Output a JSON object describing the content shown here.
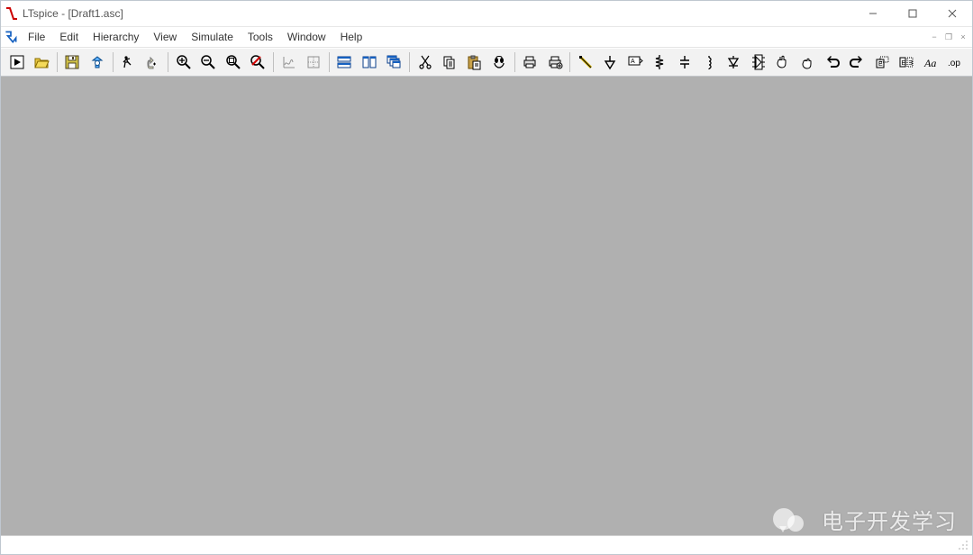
{
  "window": {
    "title": "LTspice - [Draft1.asc]"
  },
  "menus": {
    "file": "File",
    "edit": "Edit",
    "hierarchy": "Hierarchy",
    "view": "View",
    "simulate": "Simulate",
    "tools": "Tools",
    "window": "Window",
    "help": "Help"
  },
  "status": {
    "left": ""
  },
  "watermark": {
    "text": "电子开发学习"
  },
  "toolbar_buttons": [
    {
      "name": "run-simulation",
      "enabled": true
    },
    {
      "name": "open-file",
      "enabled": true
    },
    {
      "name": "separator"
    },
    {
      "name": "save",
      "enabled": true
    },
    {
      "name": "control-panel",
      "enabled": true
    },
    {
      "name": "separator"
    },
    {
      "name": "run-man",
      "enabled": true
    },
    {
      "name": "halt",
      "enabled": true
    },
    {
      "name": "separator"
    },
    {
      "name": "zoom-in",
      "enabled": true
    },
    {
      "name": "zoom-out",
      "enabled": true
    },
    {
      "name": "zoom-fit",
      "enabled": true
    },
    {
      "name": "zoom-pan-off",
      "enabled": true
    },
    {
      "name": "separator"
    },
    {
      "name": "autorange-y",
      "enabled": false
    },
    {
      "name": "autorange-x",
      "enabled": false
    },
    {
      "name": "separator"
    },
    {
      "name": "tile-horiz",
      "enabled": true
    },
    {
      "name": "tile-vert",
      "enabled": true
    },
    {
      "name": "cascade",
      "enabled": true
    },
    {
      "name": "separator"
    },
    {
      "name": "cut",
      "enabled": true
    },
    {
      "name": "copy",
      "enabled": true
    },
    {
      "name": "paste",
      "enabled": true
    },
    {
      "name": "find",
      "enabled": true
    },
    {
      "name": "separator"
    },
    {
      "name": "print",
      "enabled": true
    },
    {
      "name": "print-setup",
      "enabled": true
    },
    {
      "name": "separator"
    },
    {
      "name": "draw-wire",
      "enabled": true
    },
    {
      "name": "place-ground",
      "enabled": true
    },
    {
      "name": "label-net",
      "enabled": true
    },
    {
      "name": "place-resistor",
      "enabled": true
    },
    {
      "name": "place-capacitor",
      "enabled": true
    },
    {
      "name": "place-inductor",
      "enabled": true
    },
    {
      "name": "place-diode",
      "enabled": true
    },
    {
      "name": "place-component",
      "enabled": true
    },
    {
      "name": "move",
      "enabled": true
    },
    {
      "name": "drag",
      "enabled": true
    },
    {
      "name": "undo",
      "enabled": true
    },
    {
      "name": "redo",
      "enabled": true
    },
    {
      "name": "rotate",
      "enabled": true
    },
    {
      "name": "mirror",
      "enabled": true
    },
    {
      "name": "place-text",
      "enabled": true
    },
    {
      "name": "spice-directive",
      "enabled": true
    }
  ],
  "icon_labels": {
    "place-text": "Aa",
    "spice-directive": ".op"
  }
}
